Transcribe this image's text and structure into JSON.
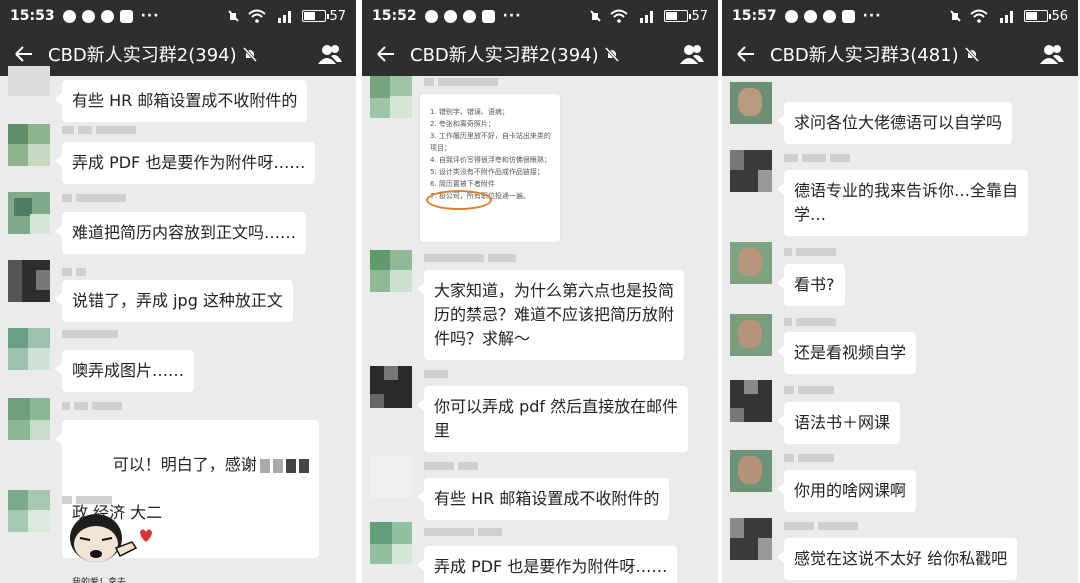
{
  "phones": [
    {
      "time": "15:53",
      "battery": "57",
      "battery_level": 0.57,
      "title": "CBD新人实习群2(394)",
      "messages": [
        "有些 HR 邮箱设置成不收附件的",
        "弄成 PDF 也是要作为附件呀……",
        "难道把简历内容放到正文吗……",
        "说错了，弄成 jpg 这种放正文",
        "噢弄成图片……",
        "可以！明白了，感谢",
        "政 经济 大二"
      ],
      "sticker_caption": "我的爱！拿去"
    },
    {
      "time": "15:52",
      "battery": "57",
      "battery_level": 0.57,
      "title": "CBD新人实习群2(394)",
      "image_lines": [
        "1. 错别字、错误、语病；",
        "2. 夸张和离奇照片；",
        "3. 工作履历里放不好，自卡站出来类的",
        "   项目；",
        "4. 自我评价写得很浮夸和仿佛很眼熟；",
        "5. 设计类没有不附作品或作品链接；",
        "6. 简历置被下者附件",
        "7. 投公司，所有职位投递一遍。"
      ],
      "messages": [
        "大家知道，为什么第六点也是投简\n历的禁忌？难道不应该把简历放附\n件吗？求解～",
        "你可以弄成 pdf 然后直接放在邮件\n里",
        "有些 HR 邮箱设置成不收附件的",
        "弄成 PDF 也是要作为附件呀……"
      ]
    },
    {
      "time": "15:57",
      "battery": "56",
      "battery_level": 0.56,
      "title": "CBD新人实习群3(481)",
      "messages": [
        "求问各位大佬德语可以自学吗",
        "德语专业的我来告诉你…全靠自\n学…",
        "看书?",
        "还是看视频自学",
        "语法书＋网课",
        "你用的啥网课啊",
        "感觉在这说不太好 给你私戳吧"
      ]
    }
  ]
}
